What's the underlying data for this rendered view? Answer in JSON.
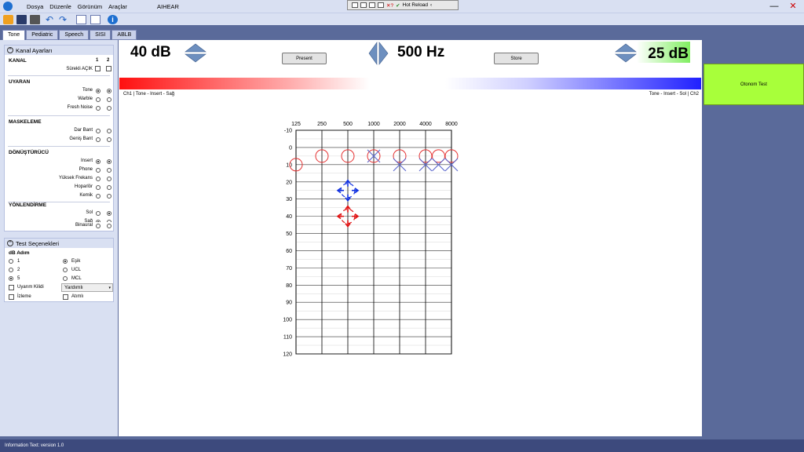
{
  "app": {
    "title": "AIHEAR",
    "menu": [
      "Dosya",
      "Düzenle",
      "Görünüm",
      "Araçlar"
    ]
  },
  "debugbar": {
    "label": "Hot Reload"
  },
  "tabs": [
    "Tone",
    "Pediatric",
    "Speech",
    "SISI",
    "ABLB"
  ],
  "kanal": {
    "title": "Kanal Ayarları",
    "header": "KANAL",
    "ch1": "1",
    "ch2": "2",
    "surekli": "Sürekli AÇIK"
  },
  "uyaran": {
    "header": "UYARAN",
    "items": [
      "Tone",
      "Warble",
      "Fresh Noise"
    ]
  },
  "maskeleme": {
    "header": "MASKELEME",
    "items": [
      "Dar Bant",
      "Geniş Bant"
    ]
  },
  "donusturucu": {
    "header": "DÖNÜŞTÜRÜCÜ",
    "items": [
      "Insert",
      "Phone",
      "Yüksek Frekans",
      "Hoparlör",
      "Kemik"
    ]
  },
  "yonlendirme": {
    "header": "YÖNLENDİRME",
    "items": [
      "Sol",
      "Sağ",
      "Binaural"
    ]
  },
  "test": {
    "title": "Test Seçenekleri",
    "dbadim": "dB Adım",
    "steps": [
      "1",
      "2",
      "5"
    ],
    "modes": [
      "Eşik",
      "UCL",
      "MCL"
    ],
    "uyarim": "Uyarım Kilidi",
    "select": "Yardımlı",
    "izleme": "İzleme",
    "atimli": "Atımlı"
  },
  "main": {
    "left_db": "40 dB",
    "freq": "500 Hz",
    "right_db": "25 dB",
    "present": "Present",
    "store": "Store",
    "ch1_label": "Ch1 | Tone - Insert - Sağ",
    "ch2_label": "Tone - Insert - Sol | Ch2"
  },
  "audiogram": {
    "freqs": [
      "125",
      "250",
      "500",
      "1000",
      "2000",
      "4000",
      "8000"
    ],
    "levels": [
      "-10",
      "0",
      "10",
      "20",
      "30",
      "40",
      "50",
      "60",
      "70",
      "80",
      "90",
      "100",
      "110",
      "120"
    ]
  },
  "chart_data": {
    "type": "scatter",
    "title": "",
    "x": [
      "125",
      "250",
      "500",
      "1000",
      "2000",
      "4000",
      "8000"
    ],
    "ylim": [
      -10,
      120
    ],
    "series": [
      {
        "symbol": "O",
        "color": "#e53030",
        "points": [
          [
            "125",
            10
          ],
          [
            "250",
            5
          ],
          [
            "500",
            5
          ],
          [
            "1000",
            5
          ],
          [
            "2000",
            5
          ],
          [
            "4000",
            5
          ],
          [
            "6000",
            5
          ],
          [
            "8000",
            5
          ]
        ]
      },
      {
        "symbol": "X",
        "color": "#5a66cc",
        "points": [
          [
            "1000",
            5
          ],
          [
            "2000",
            10
          ],
          [
            "4000",
            10
          ],
          [
            "6000",
            10
          ],
          [
            "8000",
            10
          ]
        ]
      },
      {
        "symbol": "target",
        "color": "#1030e0",
        "points": [
          [
            "500",
            25
          ]
        ]
      },
      {
        "symbol": "target",
        "color": "#e01010",
        "points": [
          [
            "500",
            40
          ]
        ]
      }
    ]
  },
  "oto": "Otonom Test",
  "status": "Information Text: version 1.0"
}
